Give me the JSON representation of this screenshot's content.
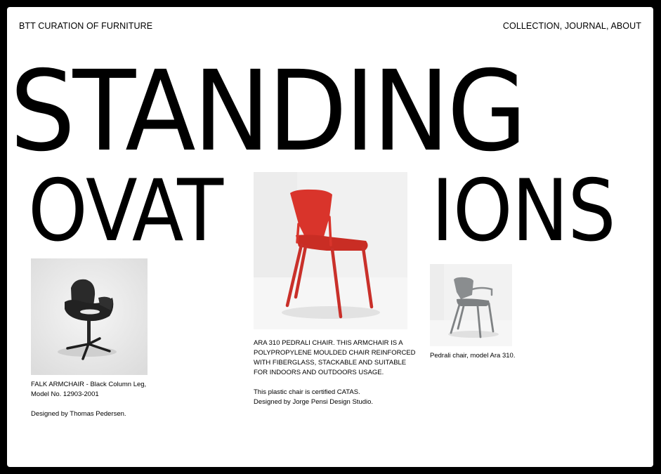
{
  "header": {
    "brand": "BTT CURATION OF FURNITURE",
    "nav": [
      "COLLECTION",
      "JOURNAL",
      "ABOUT"
    ],
    "nav_separator": ", "
  },
  "headline": {
    "line1": "STANDING",
    "line2_left": "OVAT",
    "line2_right": "IONS"
  },
  "products": [
    {
      "image_icon": "black-swivel-armchair",
      "caption_lines": [
        "FALK ARMCHAIR - Black Column Leg,",
        "Model No. 12903-2001"
      ],
      "designer": "Designed by Thomas Pedersen."
    },
    {
      "image_icon": "red-stacking-chair",
      "caption_lines": [
        "ARA 310 PEDRALI CHAIR. THIS ARMCHAIR IS A",
        "POLYPROPYLENE MOULDED CHAIR REINFORCED",
        "WITH FIBERGLASS, STACKABLE AND SUITABLE",
        "FOR INDOORS AND OUTDOORS USAGE."
      ],
      "note": "This plastic chair is certified CATAS.",
      "designer": "Designed by Jorge Pensi Design Studio."
    },
    {
      "image_icon": "grey-armchair",
      "caption_lines": [
        "Pedrali chair, model Ara 310."
      ]
    }
  ],
  "colors": {
    "background": "#ffffff",
    "frame": "#000000",
    "text": "#000000",
    "chair_red": "#d9342b",
    "chair_black": "#2a2a2a",
    "chair_grey": "#8a8d8f"
  }
}
